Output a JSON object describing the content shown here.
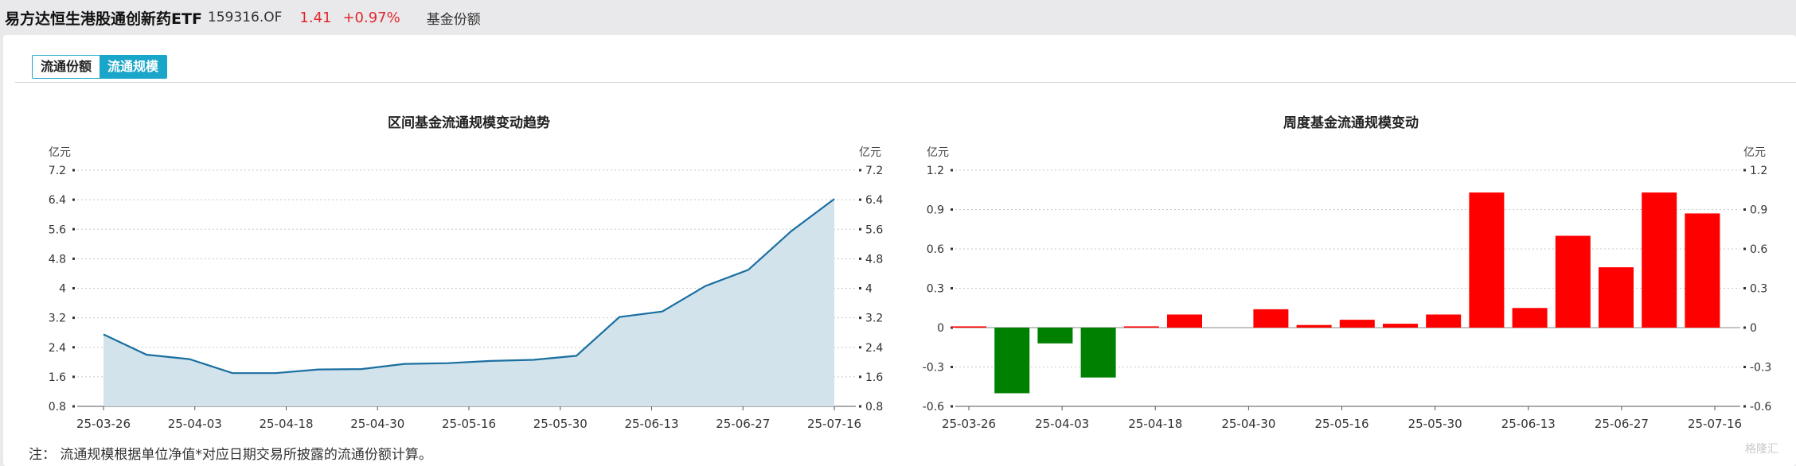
{
  "header": {
    "fund_name": "易方达恒生港股通创新药ETF",
    "fund_code": "159316.OF",
    "price": "1.41",
    "change": "+0.97%",
    "share_label": "基金份额"
  },
  "tabs": [
    {
      "label": "流通份额",
      "active": false
    },
    {
      "label": "流通规模",
      "active": true
    }
  ],
  "note": "注：  流通规模根据单位净值*对应日期交易所披露的流通份额计算。",
  "watermark": "格隆汇",
  "colors": {
    "line": "#1a6fa0",
    "area": "#d2e3ec",
    "positive": "#ff0000",
    "negative": "#008000",
    "tab_active": "#19a6c8"
  },
  "chart_data": [
    {
      "type": "area",
      "title": "区间基金流通规模变动趋势",
      "unit_left": "亿元",
      "unit_right": "亿元",
      "ylim": [
        0.8,
        7.2
      ],
      "yticks": [
        "0.8",
        "1.6",
        "2.4",
        "3.2",
        "4",
        "4.8",
        "5.6",
        "6.4",
        "7.2"
      ],
      "xticks": [
        "25-03-26",
        "25-04-03",
        "25-04-18",
        "25-04-30",
        "25-05-16",
        "25-05-30",
        "25-06-13",
        "25-06-27",
        "25-07-16"
      ],
      "grid": true,
      "values": [
        2.75,
        2.2,
        2.08,
        1.7,
        1.7,
        1.8,
        1.81,
        1.95,
        1.97,
        2.03,
        2.06,
        2.17,
        3.22,
        3.37,
        4.06,
        4.5,
        5.55,
        6.42
      ]
    },
    {
      "type": "bar",
      "title": "周度基金流通规模变动",
      "unit_left": "亿元",
      "unit_right": "亿元",
      "ylim": [
        -0.6,
        1.2
      ],
      "yticks": [
        "-0.6",
        "-0.3",
        "0",
        "0.3",
        "0.6",
        "0.9",
        "1.2"
      ],
      "xticks": [
        "25-03-26",
        "25-04-03",
        "25-04-18",
        "25-04-30",
        "25-05-16",
        "25-05-30",
        "25-06-13",
        "25-06-27",
        "25-07-16"
      ],
      "grid": true,
      "values": [
        0.01,
        -0.5,
        -0.12,
        -0.38,
        0.01,
        0.1,
        0.0,
        0.14,
        0.02,
        0.06,
        0.03,
        0.1,
        1.03,
        0.15,
        0.7,
        0.46,
        1.03,
        0.87
      ]
    }
  ]
}
